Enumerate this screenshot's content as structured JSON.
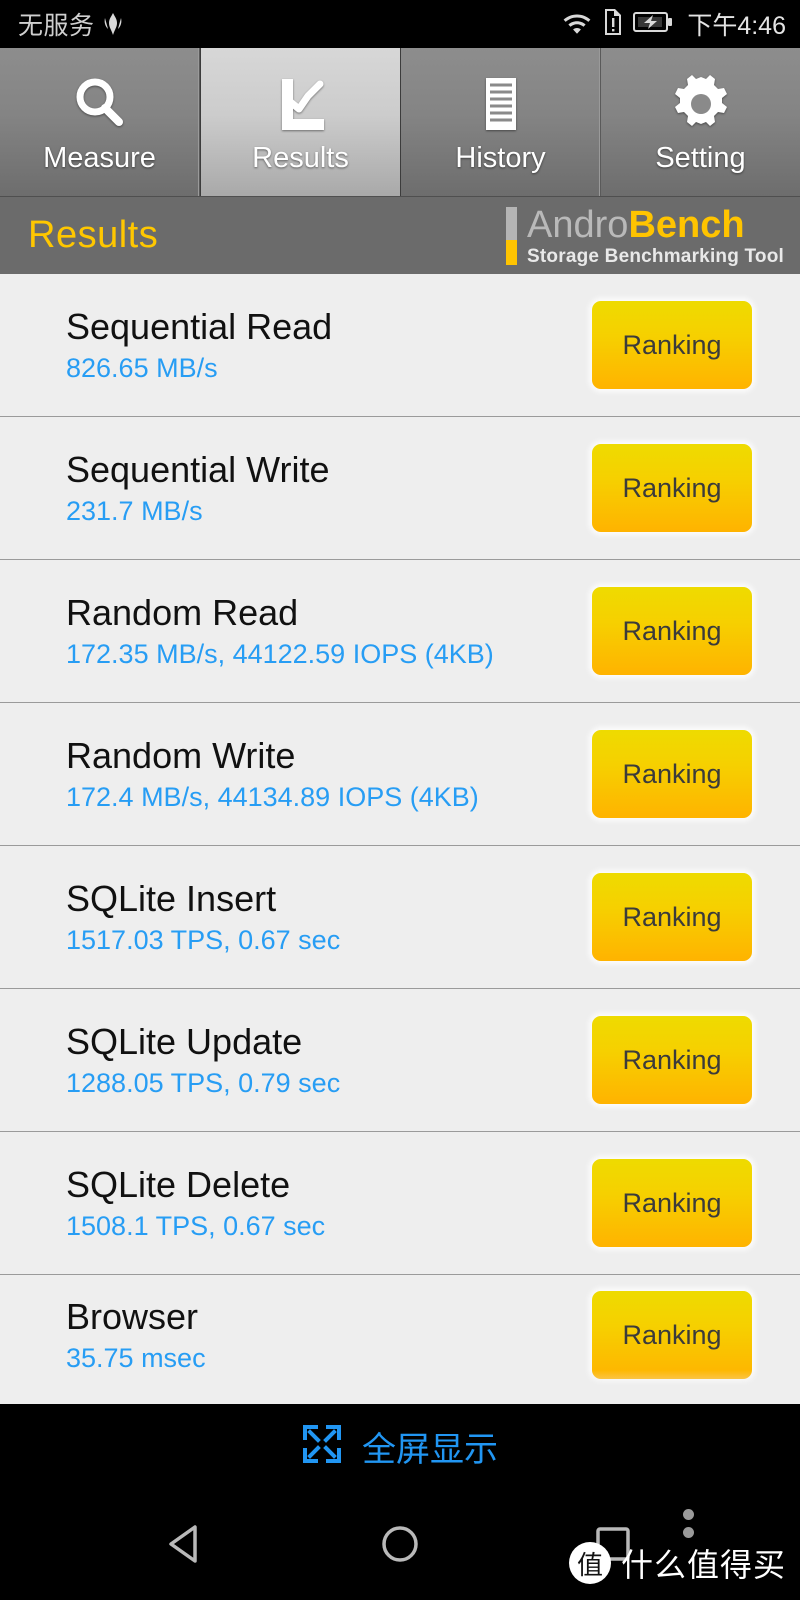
{
  "statusbar": {
    "carrier": "无服务",
    "carrier_icon": "huawei-logo-icon",
    "wifi_icon": "wifi-icon",
    "sim_icon": "sim-alert-icon",
    "battery_icon": "battery-charging-icon",
    "time": "下午4:46"
  },
  "tabs": [
    {
      "label": "Measure",
      "icon": "magnifier-icon",
      "active": false
    },
    {
      "label": "Results",
      "icon": "chart-icon",
      "active": true
    },
    {
      "label": "History",
      "icon": "document-lines-icon",
      "active": false
    },
    {
      "label": "Setting",
      "icon": "gear-icon",
      "active": false
    }
  ],
  "header": {
    "title": "Results",
    "title_color": "#ffc700",
    "logo": {
      "name_part1": "Andro",
      "name_part2": "Bench",
      "tagline": "Storage Benchmarking Tool",
      "part1_color": "#b9b9b9",
      "part2_color": "#ffc400"
    }
  },
  "results": {
    "button_label": "Ranking",
    "value_color": "#279df4",
    "rows": [
      {
        "title": "Sequential Read",
        "value": "826.65 MB/s"
      },
      {
        "title": "Sequential Write",
        "value": "231.7 MB/s"
      },
      {
        "title": "Random Read",
        "value": "172.35 MB/s, 44122.59 IOPS (4KB)"
      },
      {
        "title": "Random Write",
        "value": "172.4 MB/s, 44134.89 IOPS (4KB)"
      },
      {
        "title": "SQLite Insert",
        "value": "1517.03 TPS, 0.67 sec"
      },
      {
        "title": "SQLite Update",
        "value": "1288.05 TPS, 0.79 sec"
      },
      {
        "title": "SQLite Delete",
        "value": "1508.1 TPS, 0.67 sec"
      },
      {
        "title": "Browser",
        "value": "35.75 msec"
      }
    ]
  },
  "fullscreen_bar": {
    "label": "全屏显示",
    "icon": "expand-icon",
    "color": "#2196f3"
  },
  "navbar": {
    "back_icon": "back-triangle-icon",
    "home_icon": "home-circle-icon",
    "recents_icon": "recents-square-icon"
  },
  "watermark": {
    "badge": "值",
    "text": "什么值得买"
  }
}
